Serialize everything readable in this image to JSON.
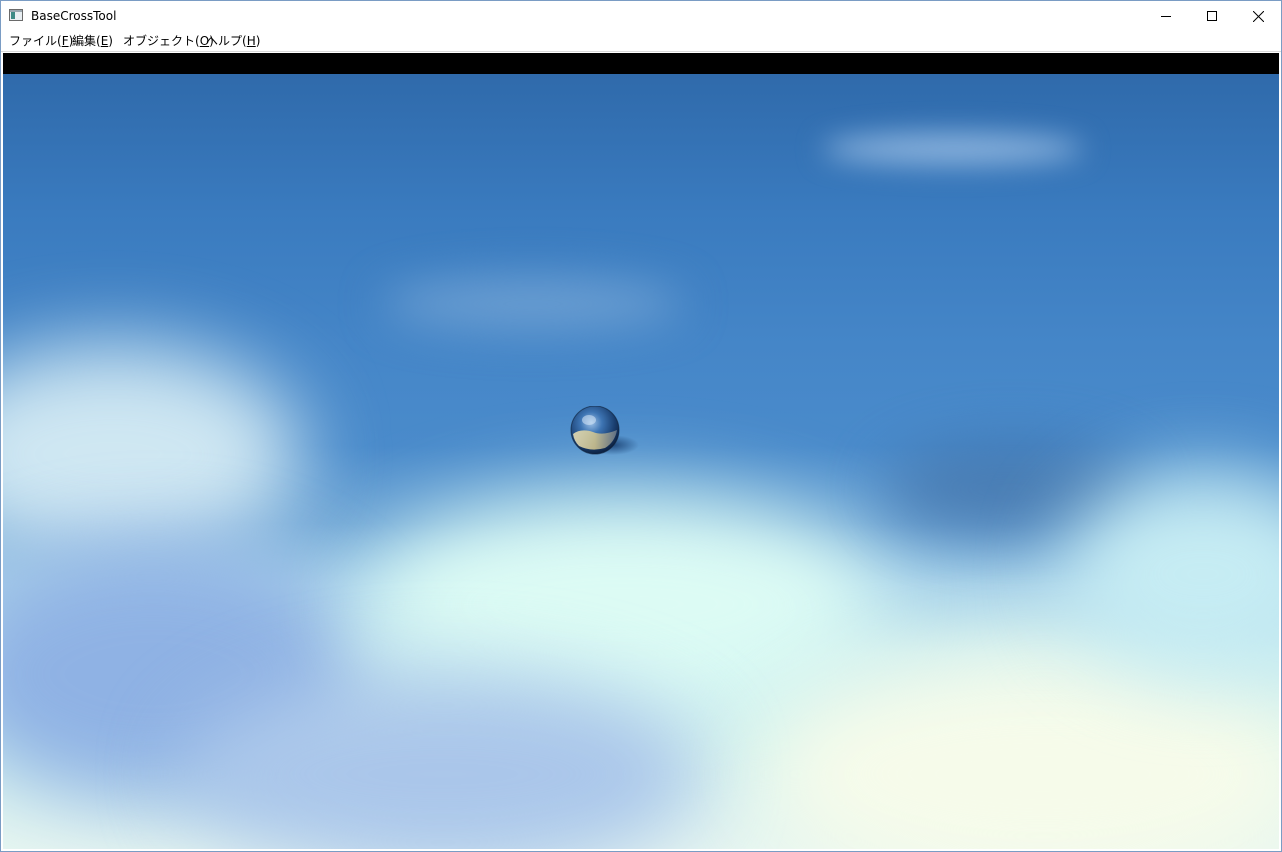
{
  "window": {
    "title": "BaseCrossTool",
    "icon": "app-window-icon",
    "controls": {
      "minimize": "minimize-icon",
      "maximize": "maximize-icon",
      "close": "close-icon"
    }
  },
  "menu": {
    "items": [
      {
        "label": "ファイル(",
        "accel": "F",
        "suffix": ")"
      },
      {
        "label": "編集(",
        "accel": "E",
        "suffix": ")"
      },
      {
        "label": "オブジェクト(",
        "accel": "O",
        "suffix": ")"
      },
      {
        "label": "ヘルプ(",
        "accel": "H",
        "suffix": ")"
      }
    ]
  },
  "scene": {
    "objects": [
      "metallic-sphere",
      "sphere-shadow"
    ],
    "colors": {
      "sky_top": "#2f6aab",
      "sky_mid": "#4a8bcb",
      "ground_light": "#d4f3ef",
      "band": "#000000"
    }
  }
}
